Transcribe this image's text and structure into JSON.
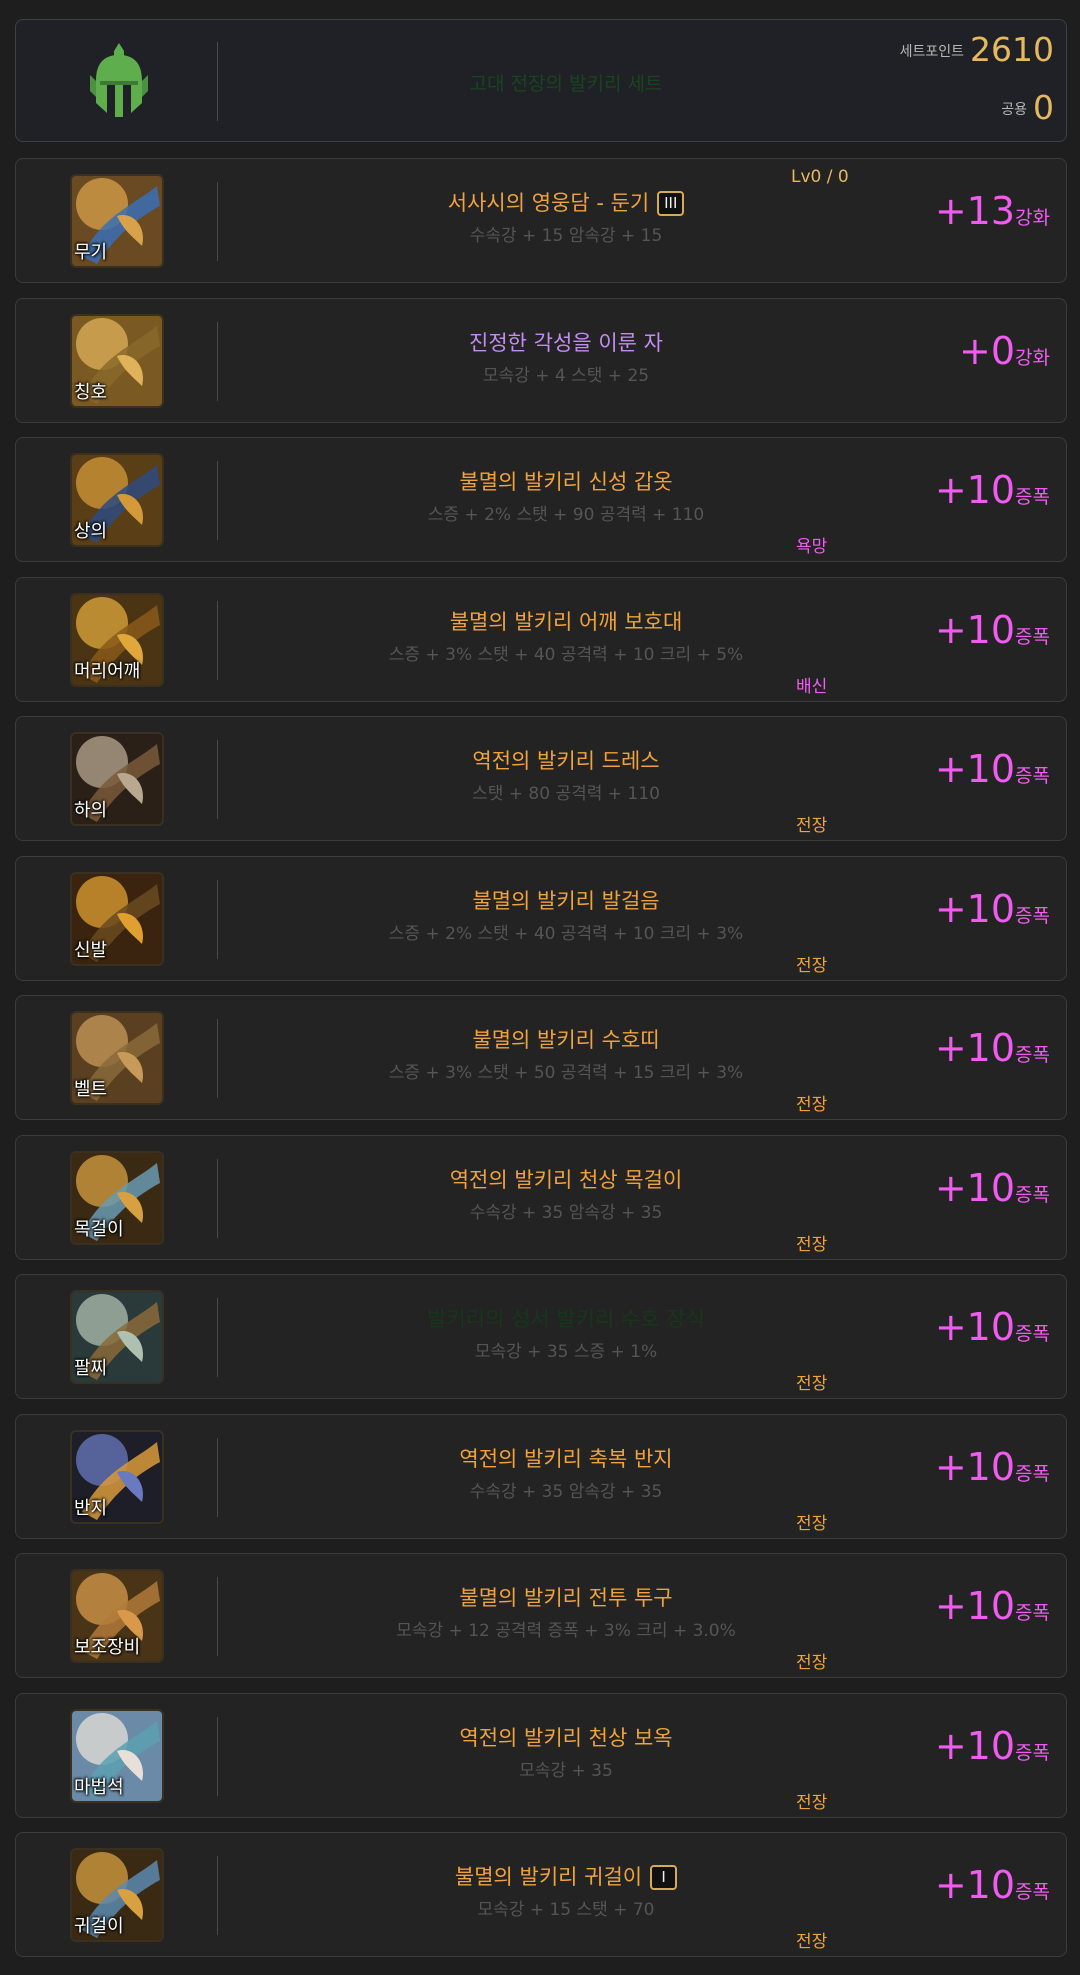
{
  "set": {
    "name": "고대 전장의 발키리 세트",
    "setpoint_label": "세트포인트",
    "setpoint_value": "2610",
    "common_label": "공용",
    "common_value": "0",
    "icon": "helmet-icon"
  },
  "colors": {
    "epic": "#f0a23c",
    "legendary": "#f0a23c",
    "unique": "#c38cf0",
    "enhance": "#f05cf0",
    "gold": "#e6b95c"
  },
  "items": [
    {
      "slot": "무기",
      "name": "서사시의 영웅담 - 둔기",
      "badge": "III",
      "level": "Lv0 / 0",
      "stat": "수속강 + 15 암속강 + 15",
      "enhance": "+13",
      "enhance_unit": "강화",
      "tag": "",
      "name_color": "#f0a23c",
      "icon": "mace-icon"
    },
    {
      "slot": "칭호",
      "name": "진정한 각성을 이룬 자",
      "badge": "",
      "level": "",
      "stat": "모속강 + 4 스탯 + 25",
      "enhance": "+0",
      "enhance_unit": "강화",
      "tag": "",
      "name_color": "#c38cf0",
      "icon": "title-icon"
    },
    {
      "slot": "상의",
      "name": "불멸의 발키리 신성 갑옷",
      "badge": "",
      "level": "",
      "stat": "스증 + 2% 스탯 + 90 공격력 + 110",
      "enhance": "+10",
      "enhance_unit": "증폭",
      "tag": "욕망",
      "name_color": "#f0a23c",
      "icon": "armor-icon"
    },
    {
      "slot": "머리어깨",
      "name": "불멸의 발키리 어깨 보호대",
      "badge": "",
      "level": "",
      "stat": "스증 + 3% 스탯 + 40 공격력 + 10 크리 + 5%",
      "enhance": "+10",
      "enhance_unit": "증폭",
      "tag": "배신",
      "name_color": "#f0a23c",
      "icon": "shoulder-icon"
    },
    {
      "slot": "하의",
      "name": "역전의 발키리 드레스",
      "badge": "",
      "level": "",
      "stat": "스탯 + 80 공격력 + 110",
      "enhance": "+10",
      "enhance_unit": "증폭",
      "tag": "전장",
      "name_color": "#f0a23c",
      "icon": "pants-icon"
    },
    {
      "slot": "신발",
      "name": "불멸의 발키리 발걸음",
      "badge": "",
      "level": "",
      "stat": "스증 + 2% 스탯 + 40 공격력 + 10 크리 + 3%",
      "enhance": "+10",
      "enhance_unit": "증폭",
      "tag": "전장",
      "name_color": "#f0a23c",
      "icon": "boots-icon"
    },
    {
      "slot": "벨트",
      "name": "불멸의 발키리 수호띠",
      "badge": "",
      "level": "",
      "stat": "스증 + 3% 스탯 + 50 공격력 + 15 크리 + 3%",
      "enhance": "+10",
      "enhance_unit": "증폭",
      "tag": "전장",
      "name_color": "#f0a23c",
      "icon": "belt-icon"
    },
    {
      "slot": "목걸이",
      "name": "역전의 발키리 천상 목걸이",
      "badge": "",
      "level": "",
      "stat": "수속강 + 35 암속강 + 35",
      "enhance": "+10",
      "enhance_unit": "증폭",
      "tag": "전장",
      "name_color": "#f0a23c",
      "icon": "necklace-icon"
    },
    {
      "slot": "팔찌",
      "name": "발키리의 성서 발키리 수호 장식",
      "badge": "",
      "level": "",
      "stat": "모속강 + 35 스증 + 1%",
      "enhance": "+10",
      "enhance_unit": "증폭",
      "tag": "전장",
      "name_color": "#17361a",
      "icon": "bracelet-icon"
    },
    {
      "slot": "반지",
      "name": "역전의 발키리 축복 반지",
      "badge": "",
      "level": "",
      "stat": "수속강 + 35 암속강 + 35",
      "enhance": "+10",
      "enhance_unit": "증폭",
      "tag": "전장",
      "name_color": "#f0a23c",
      "icon": "ring-icon"
    },
    {
      "slot": "보조장비",
      "name": "불멸의 발키리 전투 투구",
      "badge": "",
      "level": "",
      "stat": "모속강 + 12 공격력 증폭 + 3% 크리 + 3.0%",
      "enhance": "+10",
      "enhance_unit": "증폭",
      "tag": "전장",
      "name_color": "#f0a23c",
      "icon": "sub-equip-icon"
    },
    {
      "slot": "마법석",
      "name": "역전의 발키리 천상 보옥",
      "badge": "",
      "level": "",
      "stat": "모속강 + 35",
      "enhance": "+10",
      "enhance_unit": "증폭",
      "tag": "전장",
      "name_color": "#f0a23c",
      "icon": "magic-stone-icon"
    },
    {
      "slot": "귀걸이",
      "name": "불멸의 발키리 귀걸이",
      "badge": "I",
      "level": "",
      "stat": "모속강 + 15 스탯 + 70",
      "enhance": "+10",
      "enhance_unit": "증폭",
      "tag": "전장",
      "name_color": "#f0a23c",
      "icon": "earring-icon"
    }
  ]
}
